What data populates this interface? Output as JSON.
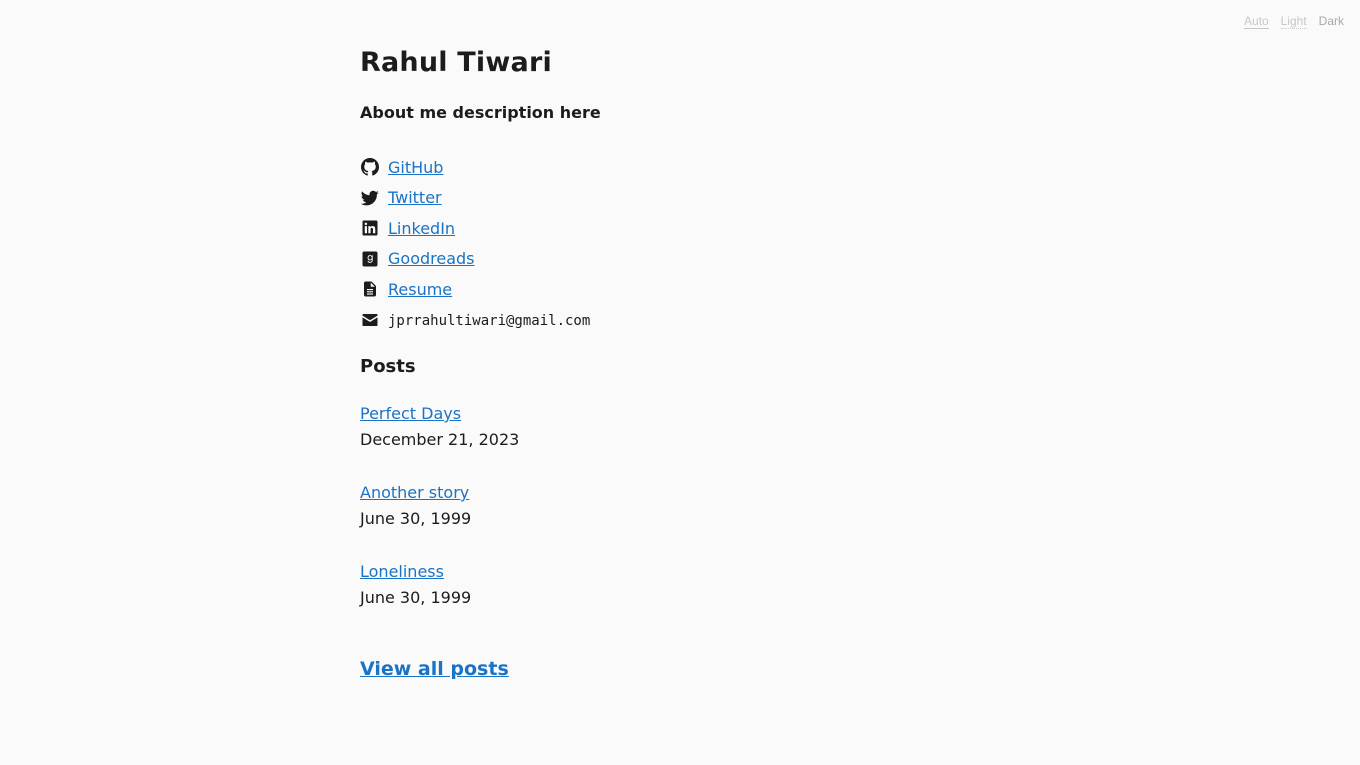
{
  "theme_switch": {
    "auto": "Auto",
    "light": "Light",
    "dark": "Dark"
  },
  "profile": {
    "name": "Rahul Tiwari",
    "about": "About me description here"
  },
  "links": [
    {
      "icon": "github-icon",
      "label": "GitHub"
    },
    {
      "icon": "twitter-icon",
      "label": "Twitter"
    },
    {
      "icon": "linkedin-icon",
      "label": "LinkedIn"
    },
    {
      "icon": "goodreads-icon",
      "label": "Goodreads"
    },
    {
      "icon": "document-icon",
      "label": "Resume"
    },
    {
      "icon": "envelope-icon",
      "label": "jprrahultiwari@gmail.com"
    }
  ],
  "posts": {
    "heading": "Posts",
    "items": [
      {
        "title": "Perfect Days",
        "date": "December 21, 2023"
      },
      {
        "title": "Another story",
        "date": "June 30, 1999"
      },
      {
        "title": "Loneliness",
        "date": "June 30, 1999"
      }
    ],
    "view_all": "View all posts"
  },
  "colors": {
    "background": "#fafafa",
    "text": "#1c1c1c",
    "link": "#1a73c5"
  }
}
